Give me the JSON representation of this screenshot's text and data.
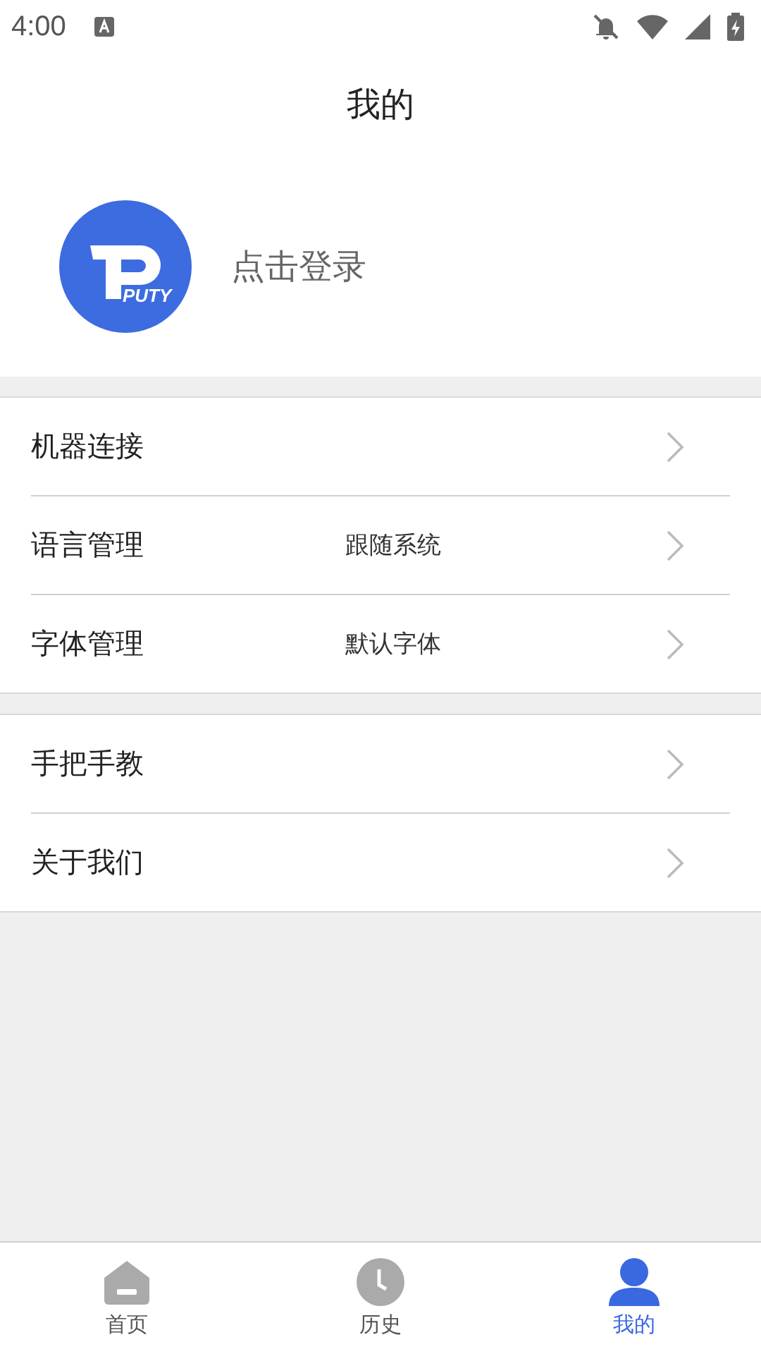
{
  "status_bar": {
    "time": "4:00"
  },
  "title": "我的",
  "profile": {
    "logo_text": "PUTY",
    "login": "点击登录"
  },
  "groups": [
    {
      "items": [
        {
          "label": "机器连接"
        },
        {
          "label": "语言管理",
          "value": "跟随系统"
        },
        {
          "label": "字体管理",
          "value": "默认字体"
        }
      ]
    },
    {
      "items": [
        {
          "label": "手把手教"
        },
        {
          "label": "关于我们"
        }
      ]
    }
  ],
  "tabs": [
    {
      "label": "首页",
      "kind": "home",
      "selected": false
    },
    {
      "label": "历史",
      "kind": "history",
      "selected": false
    },
    {
      "label": "我的",
      "kind": "profile",
      "selected": true
    }
  ]
}
